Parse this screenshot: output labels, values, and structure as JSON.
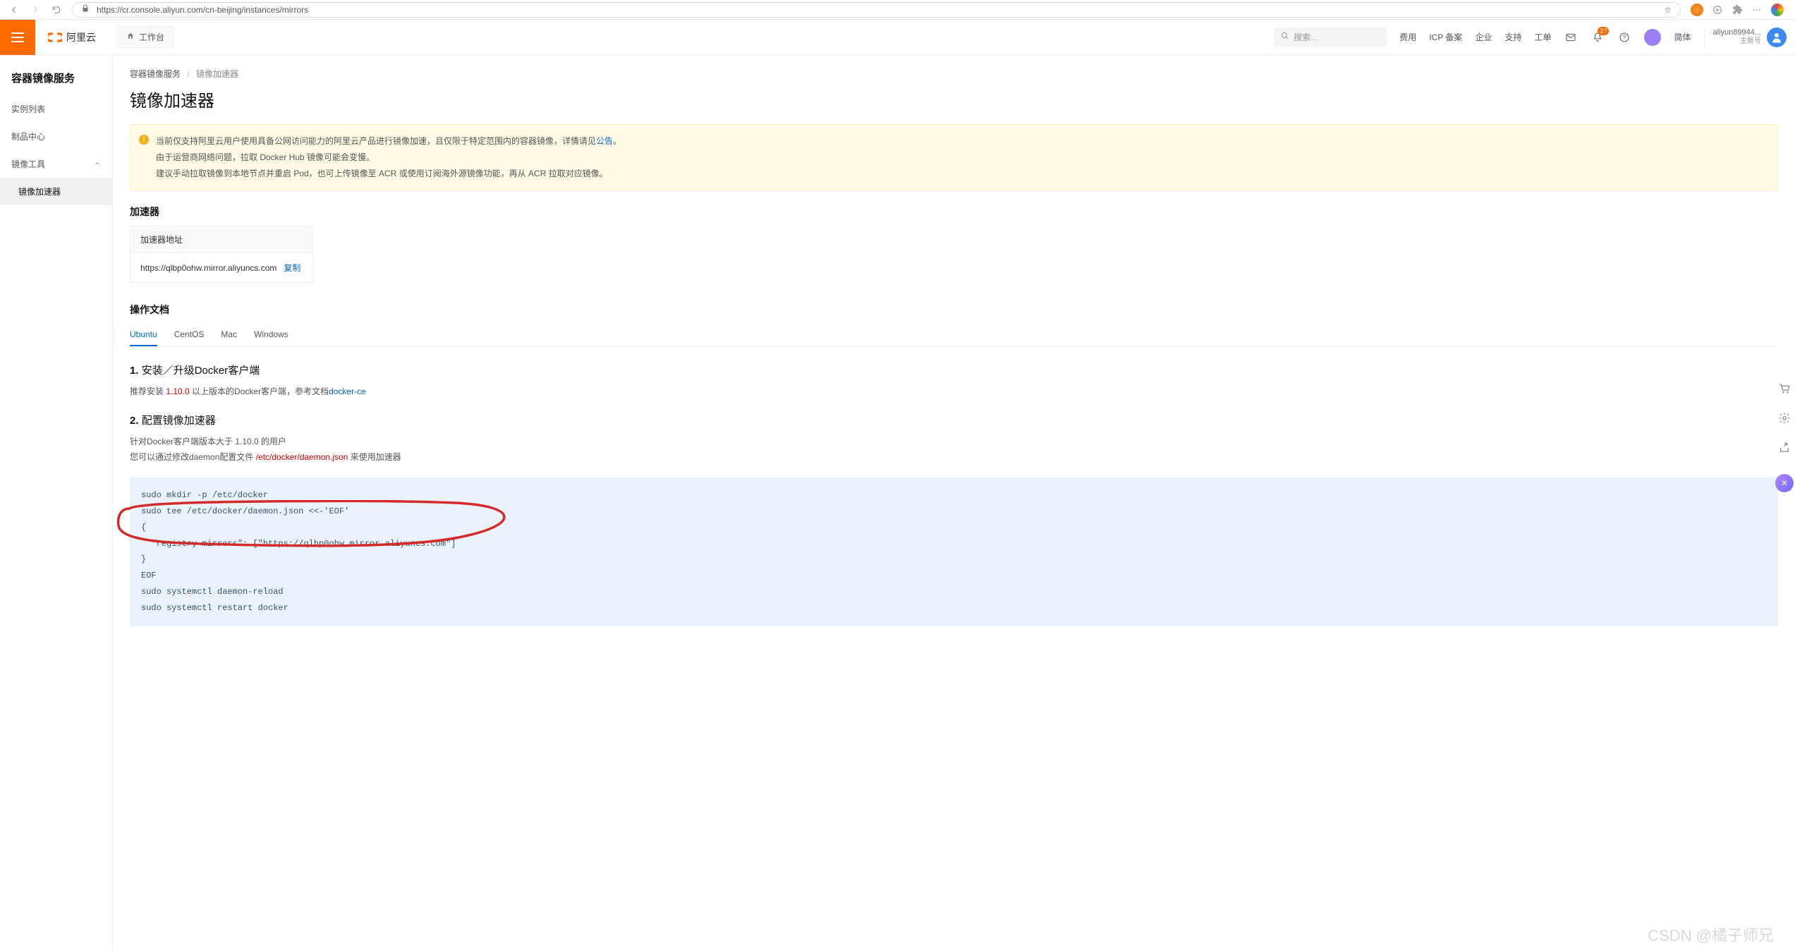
{
  "browser": {
    "url": "https://cr.console.aliyun.com/cn-beijing/instances/mirrors"
  },
  "header": {
    "brand": "阿里云",
    "workspace": "工作台",
    "search_placeholder": "搜索...",
    "links": [
      "费用",
      "ICP 备案",
      "企业",
      "支持",
      "工单"
    ],
    "lang": "简体",
    "notif_count": "27",
    "user_name": "aliyun89944...",
    "user_sub": "主账号"
  },
  "sidebar": {
    "title": "容器镜像服务",
    "items": [
      {
        "label": "实例列表",
        "active": false,
        "sub": false
      },
      {
        "label": "制品中心",
        "active": false,
        "sub": false
      },
      {
        "label": "镜像工具",
        "active": false,
        "sub": false,
        "expand": true
      },
      {
        "label": "镜像加速器",
        "active": true,
        "sub": true
      }
    ]
  },
  "breadcrumb": {
    "root": "容器镜像服务",
    "current": "镜像加速器"
  },
  "page": {
    "title": "镜像加速器"
  },
  "alert": {
    "line1_a": "当前仅支持阿里云用户使用具备公网访问能力的阿里云产品进行镜像加速，且仅限于特定范围内的容器镜像，详情请见",
    "line1_link": "公告",
    "line1_b": "。",
    "line2": "由于运营商网络问题，拉取 Docker Hub 镜像可能会变慢。",
    "line3": "建议手动拉取镜像到本地节点并重启 Pod，也可上传镜像至 ACR 或使用订阅海外源镜像功能，再从 ACR 拉取对应镜像。"
  },
  "accel": {
    "title": "加速器",
    "addr_label": "加速器地址",
    "addr_value": "https://qlbp0ohw.mirror.aliyuncs.com",
    "copy": "复制"
  },
  "docs": {
    "title": "操作文档",
    "tabs": [
      "Ubuntu",
      "CentOS",
      "Mac",
      "Windows"
    ],
    "active_tab": 0,
    "step1": {
      "num": "1.",
      "title": "安装／升级Docker客户端",
      "text_a": "推荐安装 ",
      "text_ver": "1.10.0",
      "text_b": " 以上版本的Docker客户端，参考文档",
      "link": "docker-ce"
    },
    "step2": {
      "num": "2.",
      "title": "配置镜像加速器",
      "text_a": "针对Docker客户端版本大于 1.10.0 的用户",
      "text_b_pre": "您可以通过修改daemon配置文件 ",
      "text_b_path": "/etc/docker/daemon.json",
      "text_b_post": " 来使用加速器",
      "code": "sudo mkdir -p /etc/docker\nsudo tee /etc/docker/daemon.json <<-'EOF'\n{\n  \"registry-mirrors\": [\"https://qlbp0ohw.mirror.aliyuncs.com\"]\n}\nEOF\nsudo systemctl daemon-reload\nsudo systemctl restart docker"
    }
  },
  "watermark": "CSDN @橘子师兄"
}
